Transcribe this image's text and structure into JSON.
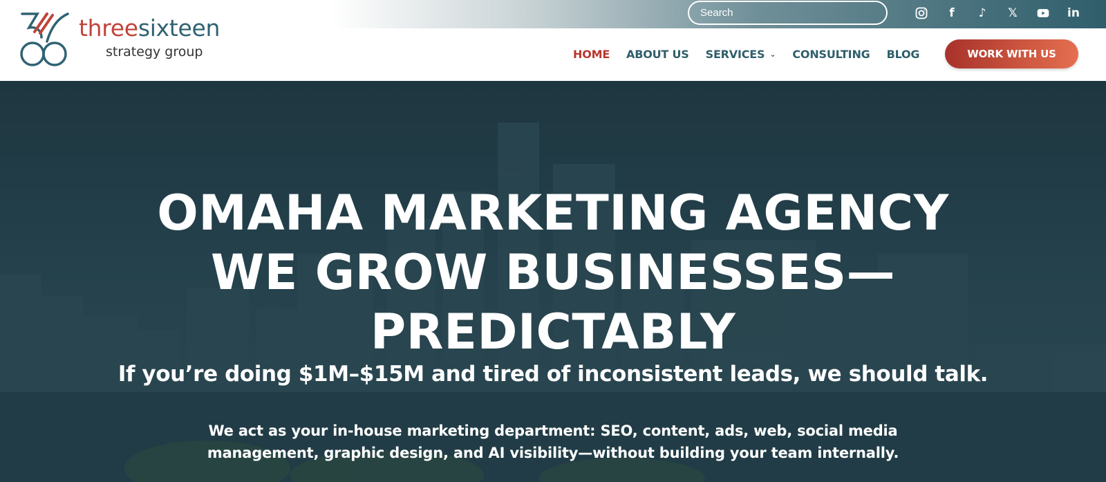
{
  "brand": {
    "word_part1": "three",
    "word_part2": "sixteen",
    "subline": "strategy group",
    "colors": {
      "accent_red": "#c0443a",
      "brand_teal": "#2f6272",
      "hero_bg": "#24414c"
    }
  },
  "search": {
    "placeholder": "Search"
  },
  "socials": [
    {
      "icon": "instagram-icon"
    },
    {
      "icon": "facebook-icon",
      "glyph": "f"
    },
    {
      "icon": "tiktok-icon",
      "glyph": "♪"
    },
    {
      "icon": "x-icon",
      "glyph": "𝕏"
    },
    {
      "icon": "youtube-icon"
    },
    {
      "icon": "linkedin-icon",
      "glyph": "in"
    }
  ],
  "nav": {
    "items": [
      {
        "label": "HOME",
        "active": true
      },
      {
        "label": "ABOUT US"
      },
      {
        "label": "SERVICES",
        "dropdown": true
      },
      {
        "label": "CONSULTING"
      },
      {
        "label": "BLOG"
      }
    ],
    "cta_label": "WORK WITH US"
  },
  "hero": {
    "title_line1": "OMAHA MARKETING AGENCY",
    "title_line2": "WE GROW BUSINESSES—",
    "title_line3": "PREDICTABLY",
    "subtitle": "If you’re doing $1M–$15M and tired of inconsistent leads, we should talk.",
    "body": "We act as your in-house marketing department: SEO, content, ads, web, social media management, graphic design, and AI visibility—without building your team internally."
  }
}
